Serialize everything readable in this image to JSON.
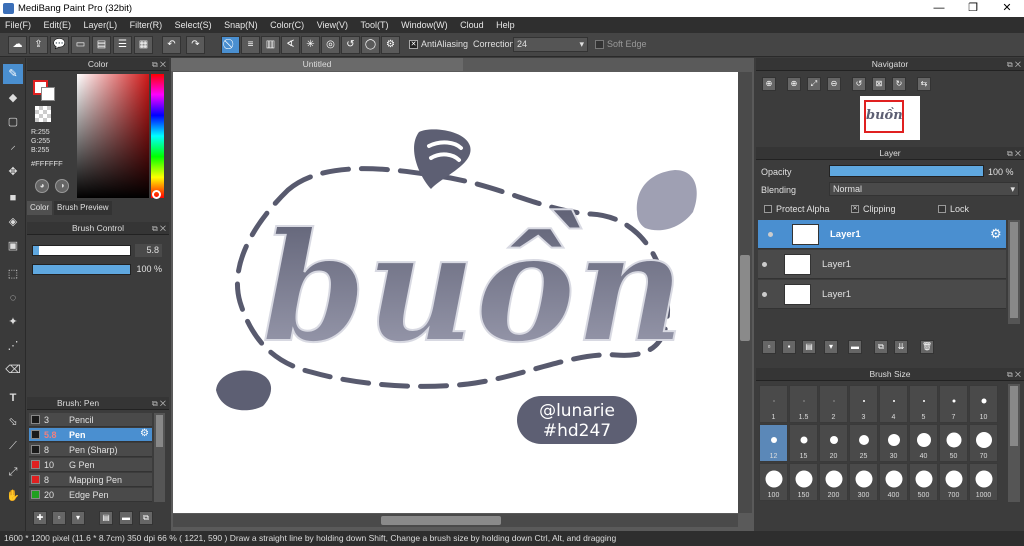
{
  "window": {
    "title": "MediBang Paint Pro (32bit)",
    "minimize": "—",
    "restore": "❐",
    "close": "✕"
  },
  "menu": [
    "File(F)",
    "Edit(E)",
    "Layer(L)",
    "Filter(R)",
    "Select(S)",
    "Snap(N)",
    "Color(C)",
    "View(V)",
    "Tool(T)",
    "Window(W)",
    "Cloud",
    "Help"
  ],
  "toolbar": {
    "antialiasing_label": "AntiAliasing",
    "correction_label": "Correction",
    "correction_value": "24",
    "soft_edge_label": "Soft Edge"
  },
  "color_panel": {
    "title": "Color",
    "r": "R:255",
    "g": "G:255",
    "b": "B:255",
    "hex": "#FFFFFF",
    "tab_color": "Color",
    "tab_brush_preview": "Brush Preview"
  },
  "brush_control": {
    "title": "Brush Control",
    "size_value": "5.8",
    "opacity_value": "100 %",
    "opacity_fraction": 1.0
  },
  "brush_list": {
    "title": "Brush: Pen",
    "items": [
      {
        "size": "3",
        "name": "Pencil",
        "color": "#1a1a1a"
      },
      {
        "size": "5.8",
        "name": "Pen",
        "color": "#1a1a1a"
      },
      {
        "size": "8",
        "name": "Pen (Sharp)",
        "color": "#1a1a1a"
      },
      {
        "size": "10",
        "name": "G Pen",
        "color": "#e02020"
      },
      {
        "size": "8",
        "name": "Mapping Pen",
        "color": "#e02020"
      },
      {
        "size": "20",
        "name": "Edge Pen",
        "color": "#20a020"
      }
    ]
  },
  "canvas": {
    "tab": "Untitled"
  },
  "artwork": {
    "main_word": "buồn",
    "tag_line1": "@lunarie",
    "tag_line2": "#hd247"
  },
  "navigator": {
    "title": "Navigator"
  },
  "layer_panel": {
    "title": "Layer",
    "opacity_label": "Opacity",
    "opacity_value": "100 %",
    "opacity_fraction": 1.0,
    "blending_label": "Blending",
    "blending_value": "Normal",
    "protect_alpha": "Protect Alpha",
    "clipping": "Clipping",
    "lock": "Lock",
    "layers": [
      "Layer1",
      "Layer1",
      "Layer1"
    ]
  },
  "brush_size": {
    "title": "Brush Size",
    "sizes": [
      "1",
      "1.5",
      "2",
      "3",
      "4",
      "5",
      "7",
      "10",
      "12",
      "15",
      "20",
      "25",
      "30",
      "40",
      "50",
      "70",
      "100",
      "150",
      "200",
      "300",
      "400",
      "500",
      "700",
      "1000"
    ]
  },
  "status": {
    "text": "1600 * 1200 pixel  (11.6 * 8.7cm)  350 dpi  66 %  ( 1221, 590 )  Draw a straight line by holding down Shift, Change a brush size by holding down Ctrl, Alt, and dragging"
  }
}
